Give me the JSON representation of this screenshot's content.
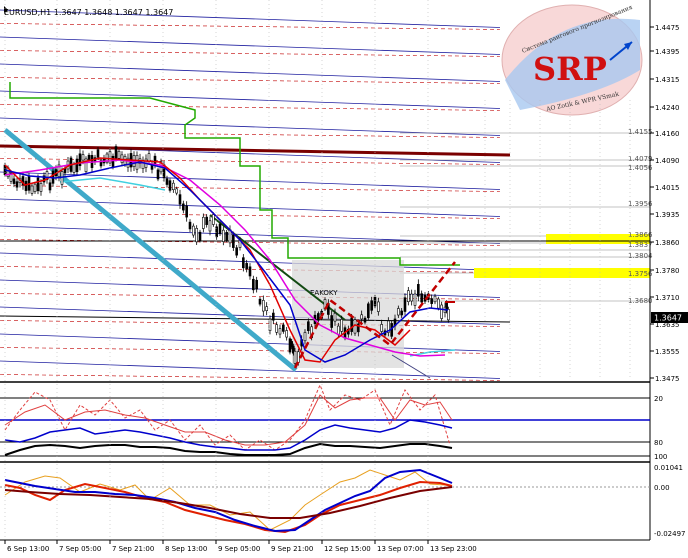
{
  "header": {
    "symbol_info": "EURUSD,H1  1.3647  1.3648  1.3647  1.3647"
  },
  "logo": {
    "text": "SRP",
    "top_arc": "Система рангового прогнозирования",
    "bottom_arc": "AO Zotik & WPR VSmak"
  },
  "colors": {
    "background": "#ffffff",
    "candle": "#000000",
    "trend_cyan": "#3fa9c9",
    "dark_red_line": "#7a0000",
    "green_line": "#22aa00",
    "blue_level": "#2020a0",
    "red_level": "#c00000",
    "magenta_ma": "#e000e0",
    "red_ma": "#e00000",
    "blue_ma": "#0000cc",
    "highlight": "#ffff00",
    "box": "#d9d9d9"
  },
  "price_axis": {
    "labels": [
      "1.4475",
      "1.4395",
      "1.4315",
      "1.4240",
      "1.4160",
      "1.4090",
      "1.4015",
      "1.3935",
      "1.3860",
      "1.3780",
      "1.3710",
      "1.3635",
      "1.3555",
      "1.3475"
    ],
    "current_price": "1.3647"
  },
  "level_labels": [
    "1.4155",
    "1.4079",
    "1.4056",
    "1.3956",
    "1.3866",
    "1.3837",
    "1.3804",
    "1.3756",
    "1.3680"
  ],
  "box_label": "EAKOKY",
  "osc1_axis": {
    "labels": [
      "20",
      "80",
      "100"
    ]
  },
  "osc2_axis": {
    "labels": [
      "0.01041",
      "0.00",
      "-0.02497"
    ]
  },
  "time_axis": {
    "labels": [
      "6 Sep 13:00",
      "7 Sep 05:00",
      "7 Sep 21:00",
      "8 Sep 13:00",
      "9 Sep 05:00",
      "9 Sep 21:00",
      "12 Sep 15:00",
      "13 Sep 07:00",
      "13 Sep 23:00"
    ]
  }
}
